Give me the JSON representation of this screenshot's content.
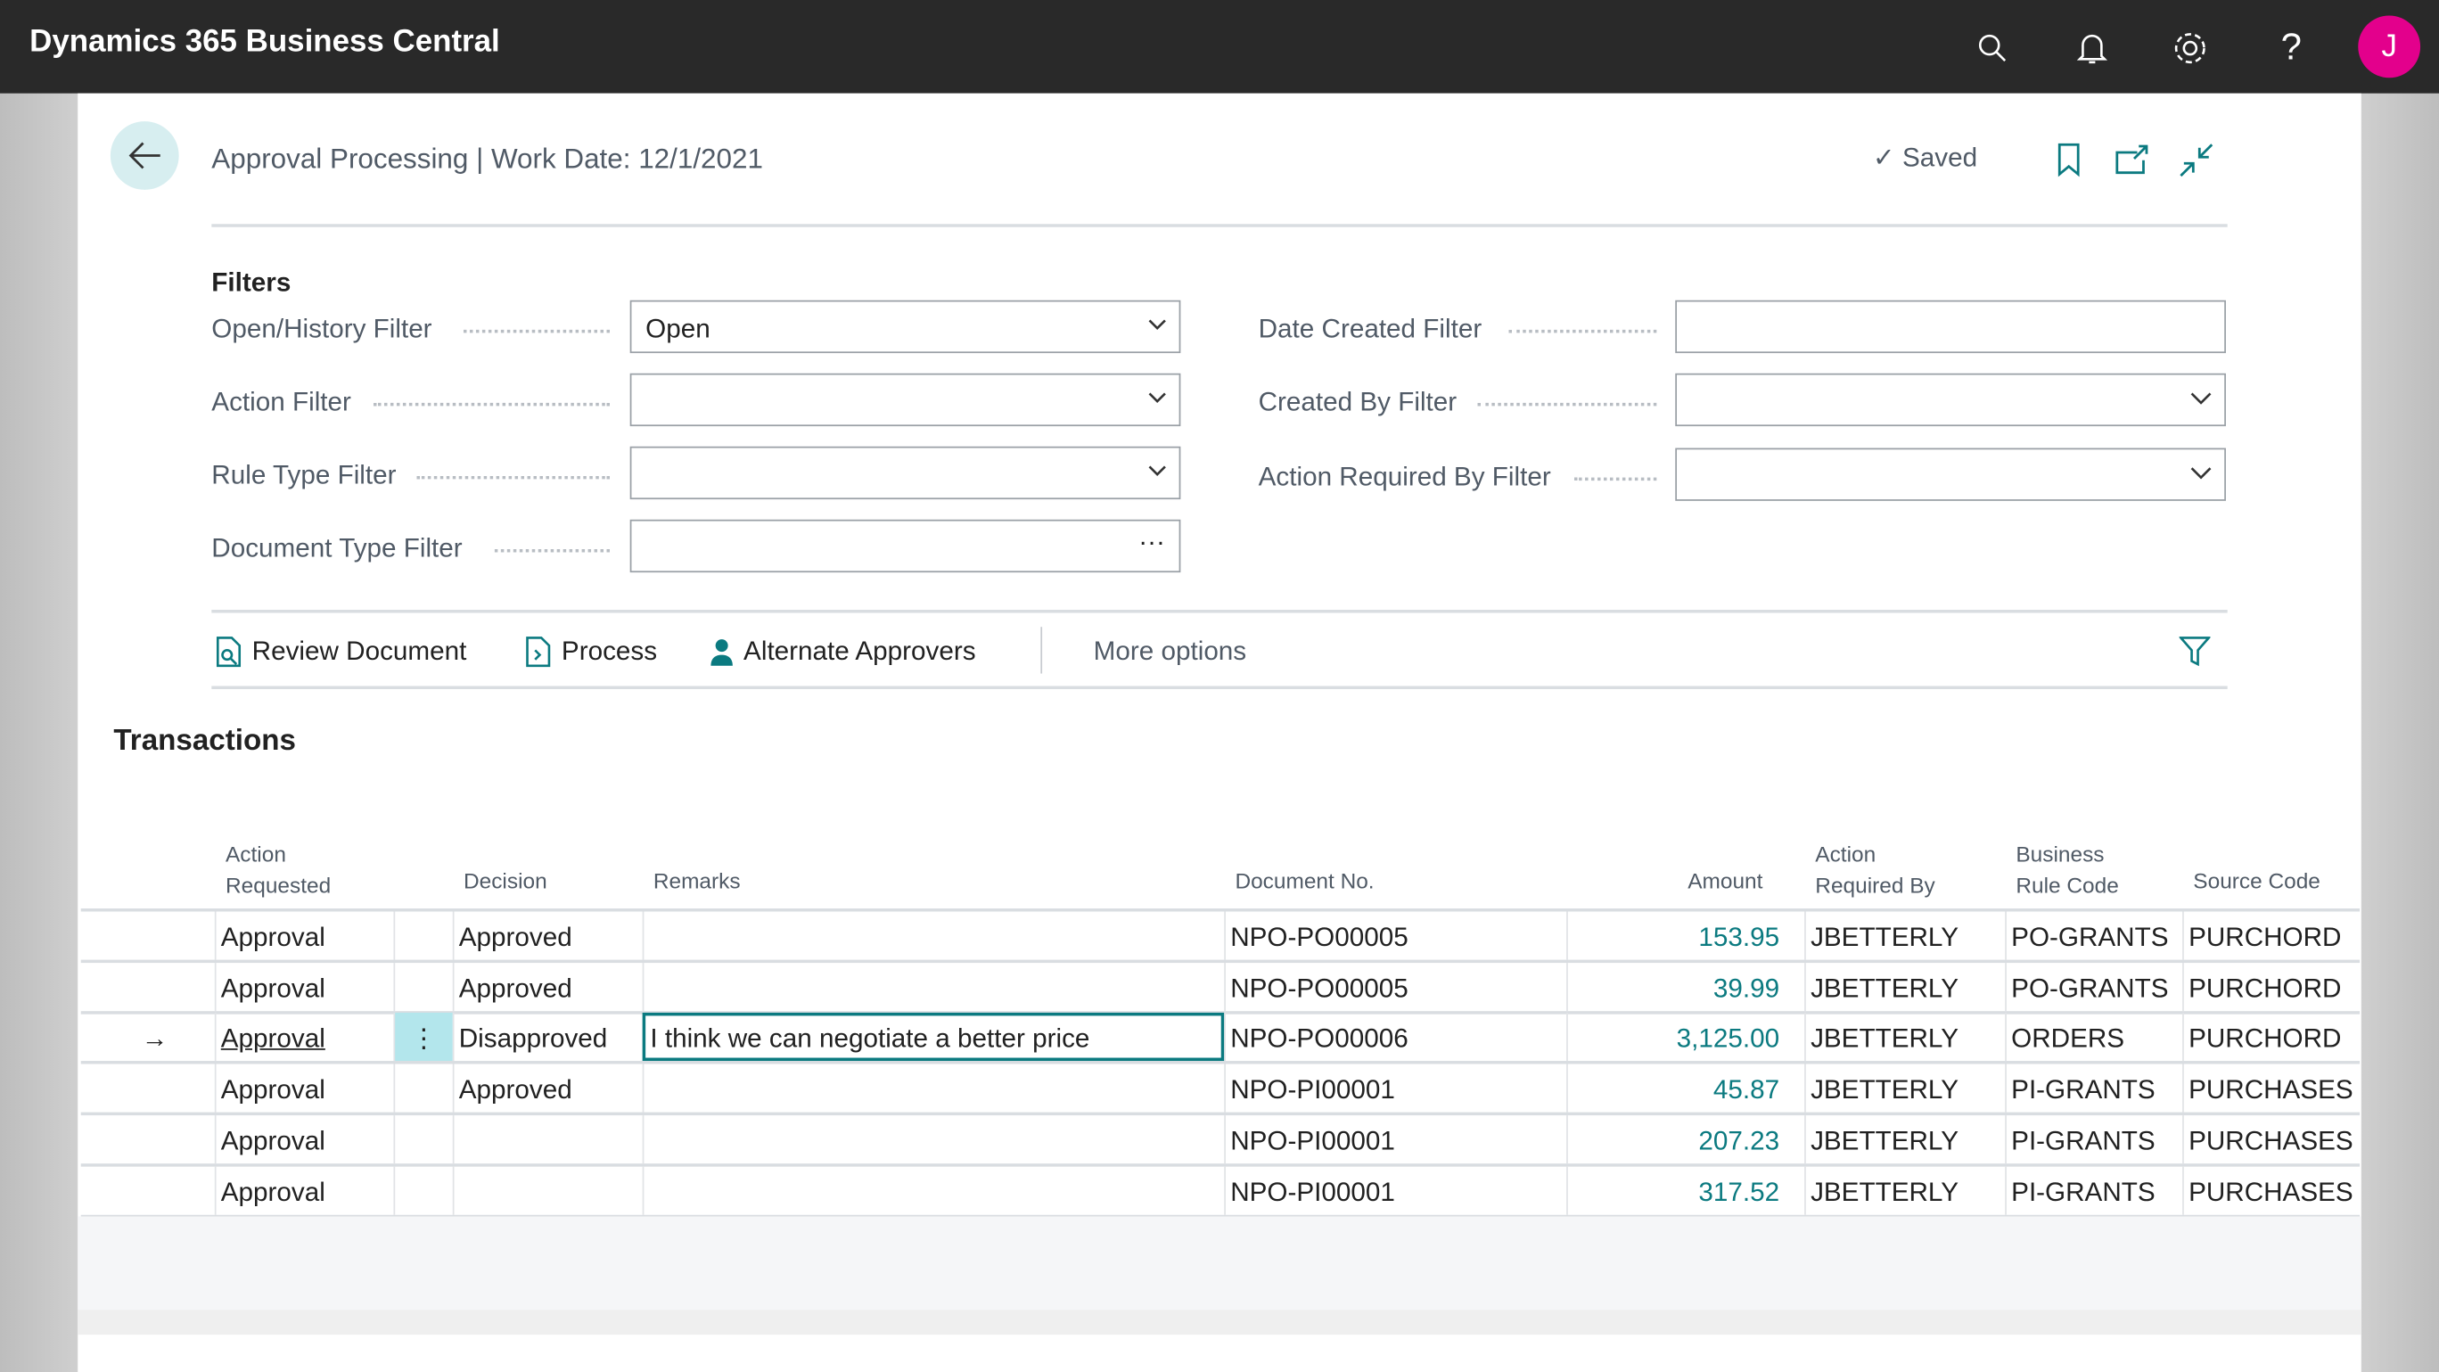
{
  "app": {
    "title": "Dynamics 365 Business Central",
    "avatar_initial": "J",
    "icons": [
      "search-icon",
      "bell-icon",
      "gear-icon",
      "help-icon"
    ]
  },
  "page": {
    "title": "Approval Processing | Work Date: 12/1/2021",
    "saved_label": "Saved"
  },
  "filters": {
    "heading": "Filters",
    "open_history": {
      "label": "Open/History Filter",
      "value": "Open"
    },
    "action": {
      "label": "Action Filter",
      "value": ""
    },
    "rule_type": {
      "label": "Rule Type Filter",
      "value": ""
    },
    "document_type": {
      "label": "Document Type Filter",
      "value": ""
    },
    "date_created": {
      "label": "Date Created Filter",
      "value": ""
    },
    "created_by": {
      "label": "Created By Filter",
      "value": ""
    },
    "action_required_by": {
      "label": "Action Required By Filter",
      "value": ""
    }
  },
  "actions": {
    "review": "Review Document",
    "process": "Process",
    "alternate": "Alternate Approvers",
    "more": "More options"
  },
  "transactions": {
    "heading": "Transactions",
    "columns": {
      "action_requested_1": "Action",
      "action_requested_2": "Requested",
      "decision": "Decision",
      "remarks": "Remarks",
      "document_no": "Document No.",
      "amount": "Amount",
      "required_by_1": "Action",
      "required_by_2": "Required By",
      "rule_code_1": "Business",
      "rule_code_2": "Rule Code",
      "source_code": "Source Code"
    },
    "rows": [
      {
        "action": "Approval",
        "decision": "Approved",
        "remarks": "",
        "doc": "NPO-PO00005",
        "amount": "153.95",
        "required_by": "JBETTERLY",
        "rule": "PO-GRANTS",
        "source": "PURCHORD"
      },
      {
        "action": "Approval",
        "decision": "Approved",
        "remarks": "",
        "doc": "NPO-PO00005",
        "amount": "39.99",
        "required_by": "JBETTERLY",
        "rule": "PO-GRANTS",
        "source": "PURCHORD"
      },
      {
        "action": "Approval",
        "decision": "Disapproved",
        "remarks": "I think we can negotiate a better price",
        "doc": "NPO-PO00006",
        "amount": "3,125.00",
        "required_by": "JBETTERLY",
        "rule": "ORDERS",
        "source": "PURCHORD",
        "selected": true
      },
      {
        "action": "Approval",
        "decision": "Approved",
        "remarks": "",
        "doc": "NPO-PI00001",
        "amount": "45.87",
        "required_by": "JBETTERLY",
        "rule": "PI-GRANTS",
        "source": "PURCHASES"
      },
      {
        "action": "Approval",
        "decision": "",
        "remarks": "",
        "doc": "NPO-PI00001",
        "amount": "207.23",
        "required_by": "JBETTERLY",
        "rule": "PI-GRANTS",
        "source": "PURCHASES"
      },
      {
        "action": "Approval",
        "decision": "",
        "remarks": "",
        "doc": "NPO-PI00001",
        "amount": "317.52",
        "required_by": "JBETTERLY",
        "rule": "PI-GRANTS",
        "source": "PURCHASES"
      }
    ]
  },
  "colors": {
    "accent": "#0b7a80",
    "topbar": "#292929",
    "avatar": "#e3008c"
  }
}
